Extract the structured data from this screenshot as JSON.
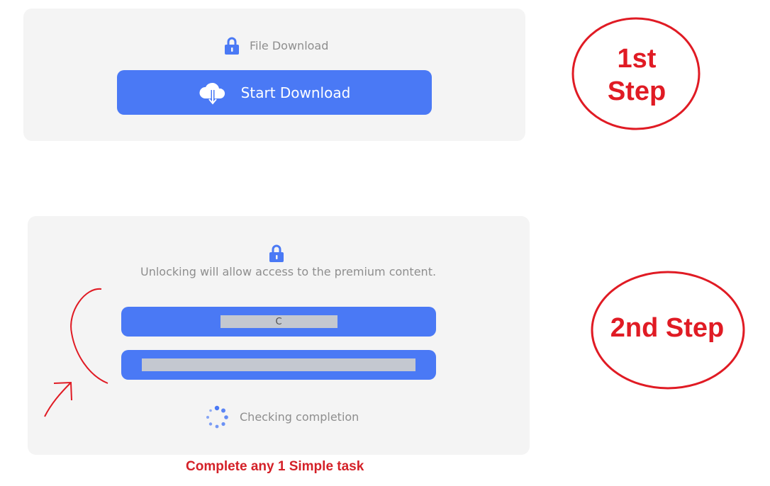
{
  "step1": {
    "header_label": "File Download",
    "button_label": "Start Download"
  },
  "step2": {
    "message": "Unlocking will allow access to the premium content.",
    "tasks": [
      {
        "label": "C"
      },
      {
        "label": ""
      }
    ],
    "status_label": "Checking completion"
  },
  "annotations": {
    "step1_label_line1": "1st",
    "step1_label_line2": "Step",
    "step2_label": "2nd Step",
    "caption": "Complete any 1 Simple task",
    "annotation_color": "#e01b24"
  },
  "colors": {
    "accent": "#4a79f5",
    "panel_bg": "#f4f4f4",
    "muted_text": "#8e8e8e"
  }
}
